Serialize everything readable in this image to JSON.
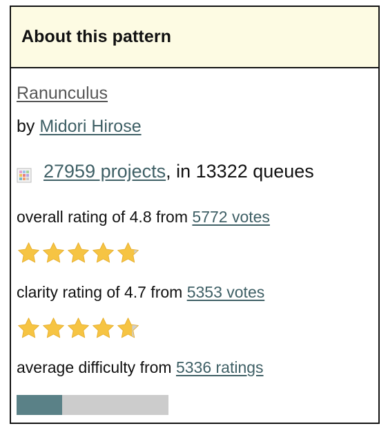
{
  "panel": {
    "title": "About this pattern"
  },
  "pattern": {
    "name": "Ranunculus",
    "by_label": "by",
    "designer": "Midori Hirose"
  },
  "projects": {
    "icon": "projects-grid-icon",
    "link_text": "27959 projects",
    "queues_text": ", in 13322 queues"
  },
  "overall": {
    "label": "overall rating of 4.8 from",
    "votes_link": "5772 votes",
    "rating": 4.8,
    "max": 5
  },
  "clarity": {
    "label": "clarity rating of 4.7 from",
    "votes_link": "5353 votes",
    "rating": 4.7,
    "max": 5
  },
  "difficulty": {
    "label": "average difficulty from",
    "ratings_link": "5336 ratings",
    "level_fraction": 0.3
  },
  "colors": {
    "header_bg": "#fdfbe3",
    "link": "#3e5f65",
    "star_fill": "#f6c443",
    "star_empty": "#cfcfcf",
    "difficulty_fill": "#5a8187",
    "difficulty_track": "#cccccc"
  }
}
